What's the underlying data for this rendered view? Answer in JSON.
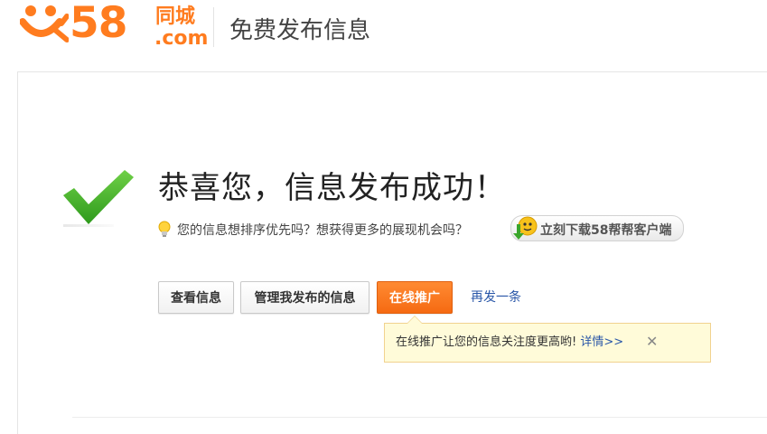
{
  "header": {
    "logo_number": "58",
    "logo_cn": "同城",
    "logo_com": ".com",
    "title": "免费发布信息"
  },
  "result": {
    "title": "恭喜您，信息发布成功！",
    "tip": "您的信息想排序优先吗？想获得更多的展现机会吗？",
    "download_label": "立刻下载58帮帮客户端"
  },
  "actions": {
    "view_label": "查看信息",
    "manage_label": "管理我发布的信息",
    "promote_label": "在线推广",
    "repost_label": "再发一条"
  },
  "tooltip": {
    "text": "在线推广让您的信息关注度更高哟!",
    "link_label": "详情>>",
    "close_symbol": "✕"
  },
  "colors": {
    "brand_orange": "#ff7c1f",
    "promote_button": "#f56a12",
    "link_blue": "#2a57a8",
    "check_green": "#4caf2b",
    "tooltip_bg": "#fffbd9"
  },
  "icons": {
    "logo_mascot": "58-mascot-icon",
    "success": "checkmark-icon",
    "tip": "lightbulb-icon",
    "download": "bangbang-mascot-download-icon",
    "close": "close-icon"
  }
}
